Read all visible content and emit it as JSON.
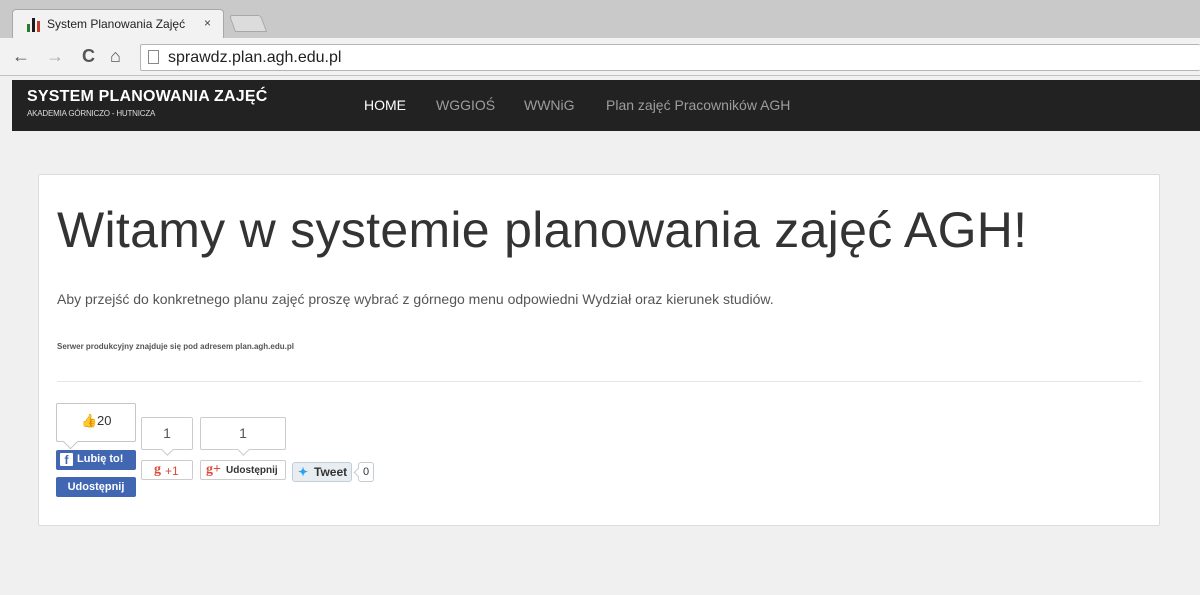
{
  "browser": {
    "tab_title": "System Planowania Zajęć",
    "tab_close": "×",
    "url": "sprawdz.plan.agh.edu.pl",
    "nav": {
      "back": "←",
      "forward": "→",
      "reload": "C",
      "home": "⌂"
    }
  },
  "navbar": {
    "brand": "SYSTEM PLANOWANIA ZAJĘĆ",
    "brand_sub": "AKADEMIA GÓRNICZO - HUTNICZA",
    "links": [
      "HOME",
      "WGGIOŚ",
      "WWNiG",
      "Plan zajęć Pracowników AGH"
    ],
    "active_index": 0
  },
  "main": {
    "heading": "Witamy w systemie planowania zajęć AGH!",
    "lead": "Aby przejść do konkretnego planu zajęć proszę wybrać z górnego menu odpowiedni Wydział oraz kierunek studiów.",
    "note": "Serwer produkcyjny znajduje się pod adresem plan.agh.edu.pl"
  },
  "social": {
    "fb_like_count": "20",
    "fb_like_label": "Lubię to!",
    "fb_share_label": "Udostępnij",
    "gplus_count": "1",
    "gplus_label": "+1",
    "gshare_count": "1",
    "gshare_label": "Udostępnij",
    "tweet_label": "Tweet",
    "tweet_count": "0",
    "colors": {
      "facebook": "#4267b2",
      "gplus": "#dd4b39",
      "twitter": "#2aa3ef"
    }
  }
}
